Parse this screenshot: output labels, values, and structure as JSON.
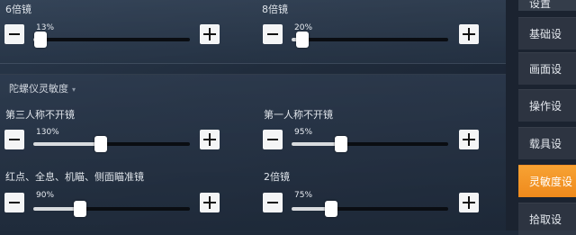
{
  "sidebar": {
    "header": "设置",
    "items": [
      {
        "label": "基础设"
      },
      {
        "label": "画面设"
      },
      {
        "label": "操作设"
      },
      {
        "label": "载具设"
      },
      {
        "label": "灵敏度设"
      },
      {
        "label": "拾取设"
      }
    ],
    "active_index": 4,
    "active_color": "#f39a2b"
  },
  "scope_sensitivity": [
    {
      "label": "6倍镜",
      "value_label": "13%",
      "value": 13
    },
    {
      "label": "8倍镜",
      "value_label": "20%",
      "value": 20
    }
  ],
  "gyroscope": {
    "title": "陀螺仪灵敏度",
    "sliders": [
      {
        "label": "第三人称不开镜",
        "value_label": "130%",
        "value": 130
      },
      {
        "label": "第一人称不开镜",
        "value_label": "95%",
        "value": 95
      },
      {
        "label": "红点、全息、机瞄、侧面瞄准镜",
        "value_label": "90%",
        "value": 90
      },
      {
        "label": "2倍镜",
        "value_label": "75%",
        "value": 75
      }
    ]
  },
  "slider_max": 300
}
